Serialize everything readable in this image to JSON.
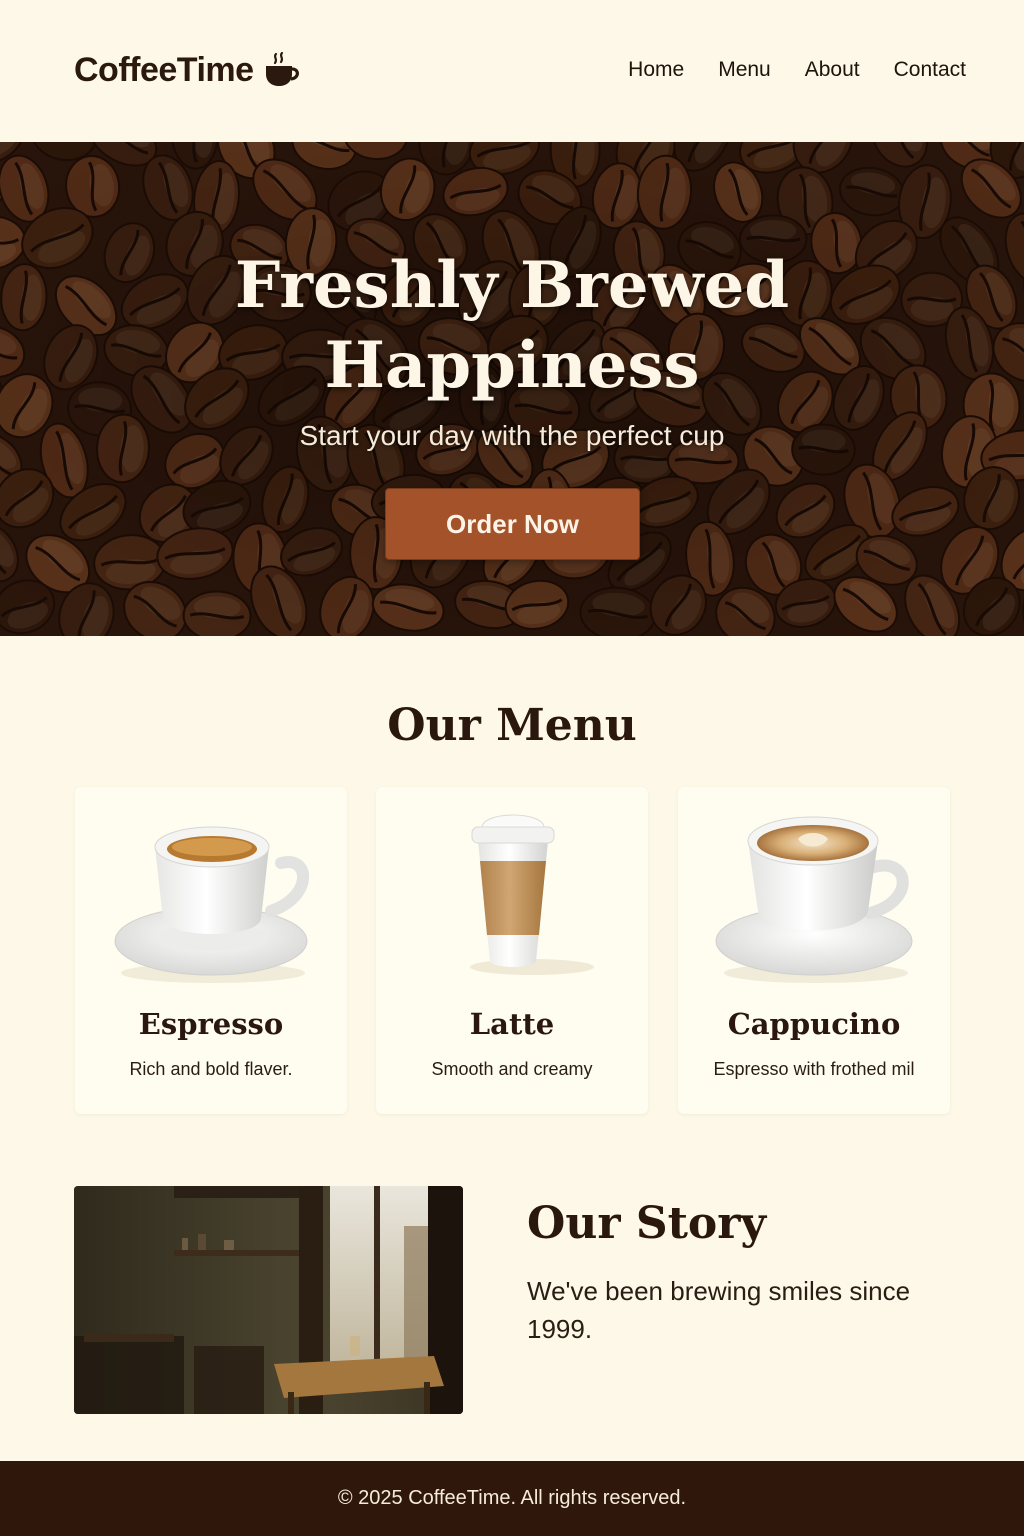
{
  "brand": {
    "name": "CoffeeTime",
    "icon": "coffee-cup-icon"
  },
  "nav": {
    "items": [
      "Home",
      "Menu",
      "About",
      "Contact"
    ]
  },
  "hero": {
    "title_line1": "Freshly Brewed",
    "title_line2": "Happiness",
    "subtitle": "Start your day with the perfect cup",
    "cta_label": "Order Now",
    "background": "coffee-beans-image"
  },
  "menu": {
    "title": "Our Menu",
    "items": [
      {
        "name": "Espresso",
        "description": "Rich and bold flaver.",
        "image": "espresso-cup-image"
      },
      {
        "name": "Latte",
        "description": "Smooth and creamy",
        "image": "takeaway-cup-image"
      },
      {
        "name": "Cappucino",
        "description": "Espresso with frothed mil",
        "image": "cappuccino-cup-image"
      }
    ]
  },
  "story": {
    "title": "Our Story",
    "text": "We've been brewing smiles since 1999.",
    "image": "cafe-interior-image"
  },
  "footer": {
    "text": "© 2025 CoffeeTime. All rights reserved."
  },
  "colors": {
    "background": "#fdf8e8",
    "text_dark": "#2a170d",
    "accent": "#a3522a",
    "footer_bg": "#2f170b",
    "card_bg": "#fffcf0"
  }
}
